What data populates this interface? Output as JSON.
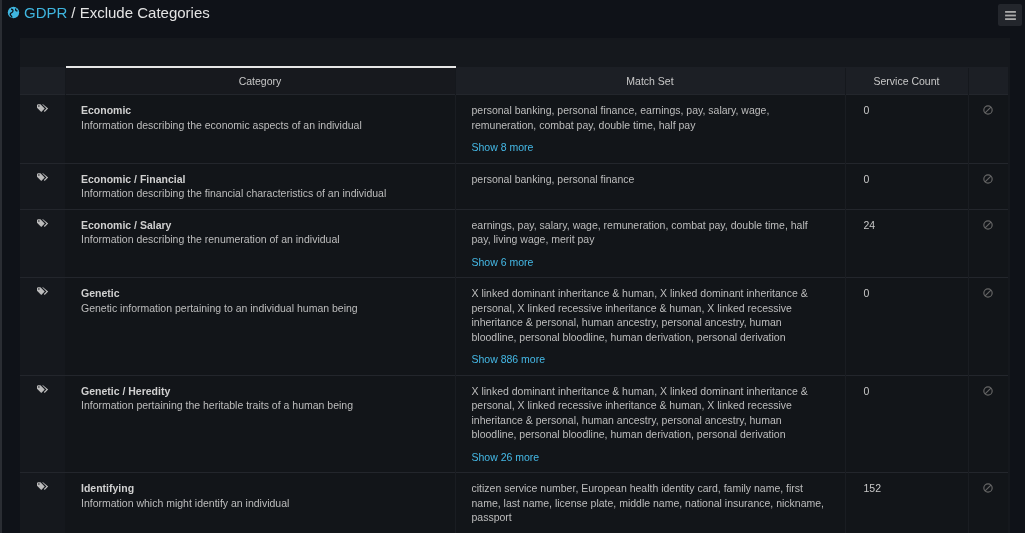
{
  "header": {
    "link": "GDPR",
    "title": "/ Exclude Categories"
  },
  "table": {
    "columns": [
      {
        "selected": false
      },
      {
        "label": "Category",
        "selected": true
      },
      {
        "label": "Match Set",
        "selected": false
      },
      {
        "label": "Service Count",
        "selected": false
      },
      {
        "selected": false
      }
    ],
    "rows": [
      {
        "name": "Economic",
        "description": "Information describing the economic aspects of an individual",
        "match_set": "personal banking, personal finance, earnings, pay, salary, wage, remuneration, combat pay, double time, half pay",
        "show_more": "Show 8 more",
        "service_count": "0"
      },
      {
        "name": "Economic / Financial",
        "description": "Information describing the financial characteristics of an individual",
        "match_set": "personal banking, personal finance",
        "service_count": "0"
      },
      {
        "name": "Economic / Salary",
        "description": "Information describing the renumeration of an individual",
        "match_set": "earnings, pay, salary, wage, remuneration, combat pay, double time, half pay, living wage, merit pay",
        "show_more": "Show 6 more",
        "service_count": "24"
      },
      {
        "name": "Genetic",
        "description": "Genetic information pertaining to an individual human being",
        "match_set": "X linked dominant inheritance & human, X linked dominant inheritance & personal, X linked recessive inheritance & human, X linked recessive inheritance & personal, human ancestry, personal ancestry, human bloodline, personal bloodline, human derivation, personal derivation",
        "show_more": "Show 886 more",
        "service_count": "0"
      },
      {
        "name": "Genetic / Heredity",
        "description": "Information pertaining the heritable traits of a human being",
        "match_set": "X linked dominant inheritance & human, X linked dominant inheritance & personal, X linked recessive inheritance & human, X linked recessive inheritance & personal, human ancestry, personal ancestry, human bloodline, personal bloodline, human derivation, personal derivation",
        "show_more": "Show 26 more",
        "service_count": "0"
      },
      {
        "name": "Identifying",
        "description": "Information which might identify an individual",
        "match_set": "citizen service number, European health identity card, family name, first name, last name, license plate, middle name, national insurance, nickname, passport",
        "service_count": "152"
      }
    ]
  }
}
